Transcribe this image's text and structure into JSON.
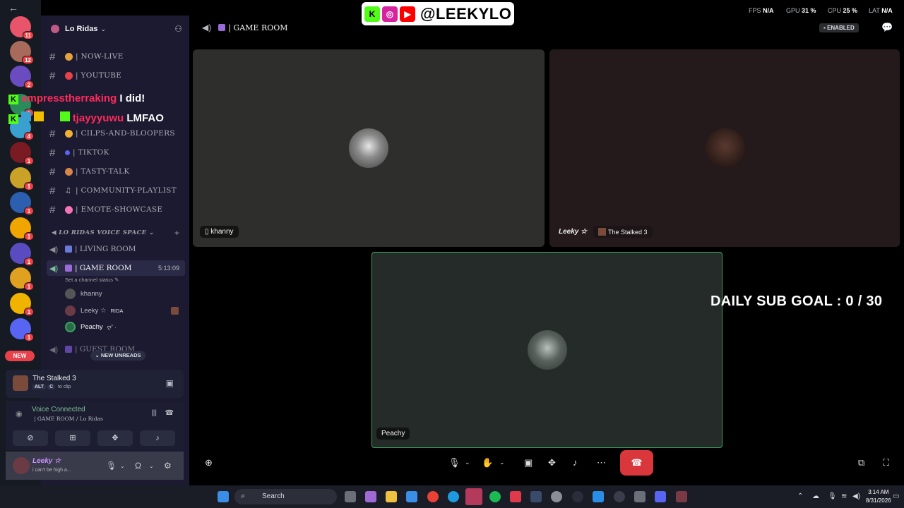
{
  "overlay": {
    "handle": "@LEEKYLO",
    "stats": [
      {
        "label": "FPS",
        "value": "N/A"
      },
      {
        "label": "GPU",
        "value": "31 %"
      },
      {
        "label": "CPU",
        "value": "25 %"
      },
      {
        "label": "LAT",
        "value": "N/A"
      }
    ],
    "chat": [
      {
        "user": "empresstherraking",
        "message": "I did!"
      },
      {
        "user": "tjayyyuwu",
        "message": "LMFAO"
      }
    ],
    "sub_goal": "DAILY SUB GOAL : 0 / 30"
  },
  "rail": {
    "badges": [
      "11",
      "12",
      "2",
      "1",
      "4",
      "1",
      "1",
      "1",
      "1",
      "1",
      "1",
      "1",
      "1"
    ],
    "new_label": "NEW"
  },
  "server": {
    "name": "Lo Ridas"
  },
  "channels": {
    "text": [
      {
        "name": "| NOW-LIVE",
        "color": "#e6a23c"
      },
      {
        "name": "| YOUTUBE",
        "color": "#e8414a"
      },
      {
        "name": "| CILPS-AND-BLOOPERS",
        "color": "#f0b132"
      },
      {
        "name": "| TIKTOK",
        "color": "#5865f2"
      },
      {
        "name": "| TASTY-TALK",
        "color": "#d8864a"
      },
      {
        "name": "| COMMUNITY-PLAYLIST",
        "color": "#8e9297"
      },
      {
        "name": "| EMOTE-SHOWCASE",
        "color": "#f472b6"
      }
    ],
    "voice_category": "LO RIDAS VOICE SPACE",
    "voice": [
      {
        "name": "| LIVING ROOM",
        "color": "#6b7ad6"
      },
      {
        "name": "| GAME ROOM",
        "color": "#9a6bd6",
        "timer": "5:13:09"
      },
      {
        "name": "| GUEST ROOM",
        "color": "#7e5ad6"
      }
    ],
    "status_hint": "Set a channel status",
    "members": [
      {
        "name": "khanny",
        "tag": ""
      },
      {
        "name": "Leeky ☆",
        "tag": "RIDA"
      },
      {
        "name": "Peachy",
        "tag": "ღ˚ ·"
      }
    ],
    "new_unreads": "NEW UNREADS"
  },
  "clip": {
    "title": "The Stalked 3",
    "keys": [
      "ALT",
      "C"
    ],
    "hint": "to clip"
  },
  "voice_status": {
    "label": "Voice Connected",
    "channel": "| GAME ROOM / Lo Ridas"
  },
  "user": {
    "name": "Leeky ☆",
    "status": "i can't be high a..."
  },
  "main": {
    "channel_title": "| GAME ROOM",
    "enabled_label": "ENABLED",
    "tiles": [
      {
        "name": "khanny"
      },
      {
        "name": "Leeky ☆",
        "activity": "The Stalked 3"
      },
      {
        "name": "Peachy"
      }
    ]
  },
  "taskbar": {
    "search": "Search",
    "time": "3:14 AM",
    "date": "8/31/2026"
  }
}
